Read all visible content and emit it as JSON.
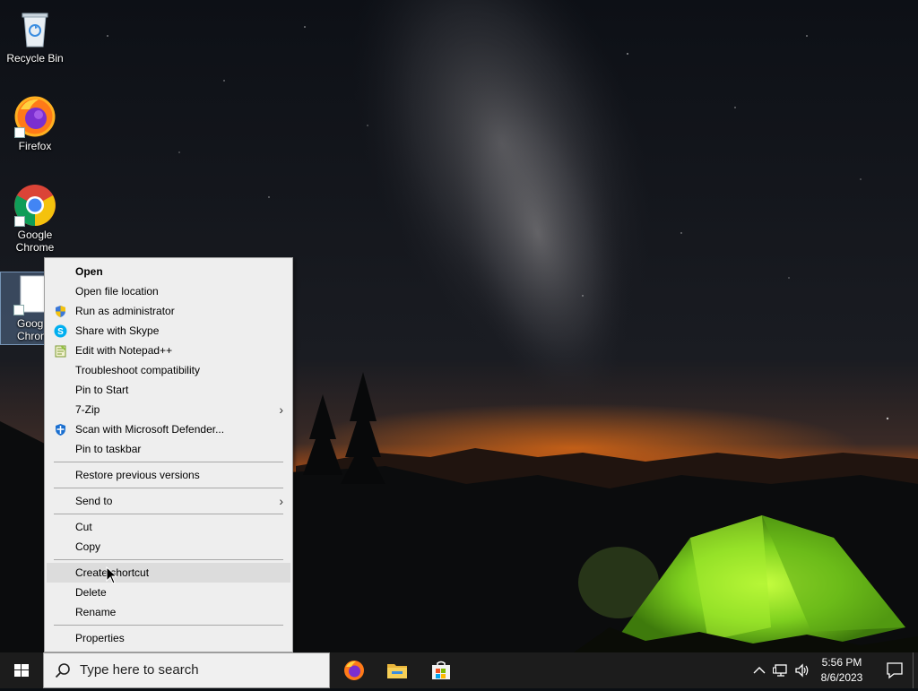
{
  "desktop": {
    "icons": [
      {
        "label": "Recycle Bin",
        "icon": "recycle-bin-icon"
      },
      {
        "label": "Firefox",
        "icon": "firefox-icon"
      },
      {
        "label": "Google Chrome",
        "icon": "chrome-icon"
      },
      {
        "label": "Goog Chron",
        "icon": "generic-file-icon"
      }
    ]
  },
  "context_menu": {
    "items": [
      {
        "label": "Open",
        "bold": true
      },
      {
        "label": "Open file location"
      },
      {
        "label": "Run as administrator",
        "icon": "shield-uac-icon"
      },
      {
        "label": "Share with Skype",
        "icon": "skype-icon"
      },
      {
        "label": "Edit with Notepad++",
        "icon": "notepadpp-icon"
      },
      {
        "label": "Troubleshoot compatibility"
      },
      {
        "label": "Pin to Start"
      },
      {
        "label": "7-Zip",
        "submenu": true
      },
      {
        "label": "Scan with Microsoft Defender...",
        "icon": "defender-icon"
      },
      {
        "label": "Pin to taskbar"
      },
      {
        "label": "Restore previous versions"
      },
      {
        "label": "Send to",
        "submenu": true
      },
      {
        "label": "Cut"
      },
      {
        "label": "Copy"
      },
      {
        "label": "Create shortcut",
        "highlighted": true
      },
      {
        "label": "Delete"
      },
      {
        "label": "Rename"
      },
      {
        "label": "Properties"
      }
    ]
  },
  "taskbar": {
    "search_placeholder": "Type here to search",
    "pinned_apps": [
      "firefox-icon",
      "file-explorer-icon",
      "microsoft-store-icon"
    ],
    "tray_icons": [
      "chevron-up-icon",
      "network-icon",
      "volume-icon"
    ],
    "clock_time": "5:56 PM",
    "clock_date": "8/6/2023"
  },
  "colors": {
    "menu_bg": "#eeeeee",
    "menu_hover": "#dcdcdc",
    "taskbar_bg": "#1c1c1c",
    "tent_green": "#7fd11f"
  }
}
